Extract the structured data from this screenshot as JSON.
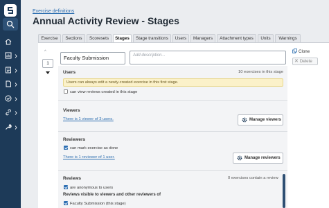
{
  "header": {
    "breadcrumb": "Exercise definitions",
    "title": "Annual Activity Review - Stages"
  },
  "tabs": [
    {
      "label": "Exercise",
      "active": false
    },
    {
      "label": "Sections",
      "active": false
    },
    {
      "label": "Scoresets",
      "active": false
    },
    {
      "label": "Stages",
      "active": true
    },
    {
      "label": "Stage transitions",
      "active": false
    },
    {
      "label": "Users",
      "active": false
    },
    {
      "label": "Managers",
      "active": false
    },
    {
      "label": "Attachment types",
      "active": false
    },
    {
      "label": "Units",
      "active": false
    },
    {
      "label": "Warnings",
      "active": false
    }
  ],
  "stage": {
    "order": "1",
    "name": "Faculty Submission",
    "description_placeholder": "Add description...",
    "clone_label": "Clone",
    "delete_label": "Delete"
  },
  "users": {
    "title": "Users",
    "count_text": "10 exercises in this stage",
    "notice": "Users can always edit a newly-created exercise in this first stage.",
    "checkbox_label": "can view reviews created in this stage",
    "checked": false
  },
  "viewers": {
    "title": "Viewers",
    "link": "There is 1 viewer of 3 users.",
    "button": "Manage viewers"
  },
  "reviewers": {
    "title": "Reviewers",
    "checkbox_label": "can mark exercise as done",
    "checked": true,
    "link": "There is 1 reviewer of 1 user.",
    "button": "Manage reviewers"
  },
  "reviews": {
    "title": "Reviews",
    "count_text": "0 exercises contain a review",
    "checkbox_label": "are anonymous to users",
    "checked": true,
    "subheading": "Reviews visible to viewers and other reviewers of",
    "stage_option": "Faculty Submission (this stage)",
    "stage_option_checked": true
  },
  "sidebar": {
    "icons": [
      "logo-icon",
      "search-icon",
      "home-icon",
      "chart-icon",
      "report-icon",
      "document-icon",
      "check-circle-icon",
      "link-icon",
      "wrench-icon"
    ]
  },
  "colors": {
    "sidebar": "#1d3a58",
    "link": "#2e6fb0",
    "notice_bg": "#fbf1c9",
    "checkbox": "#2d6fb3"
  }
}
